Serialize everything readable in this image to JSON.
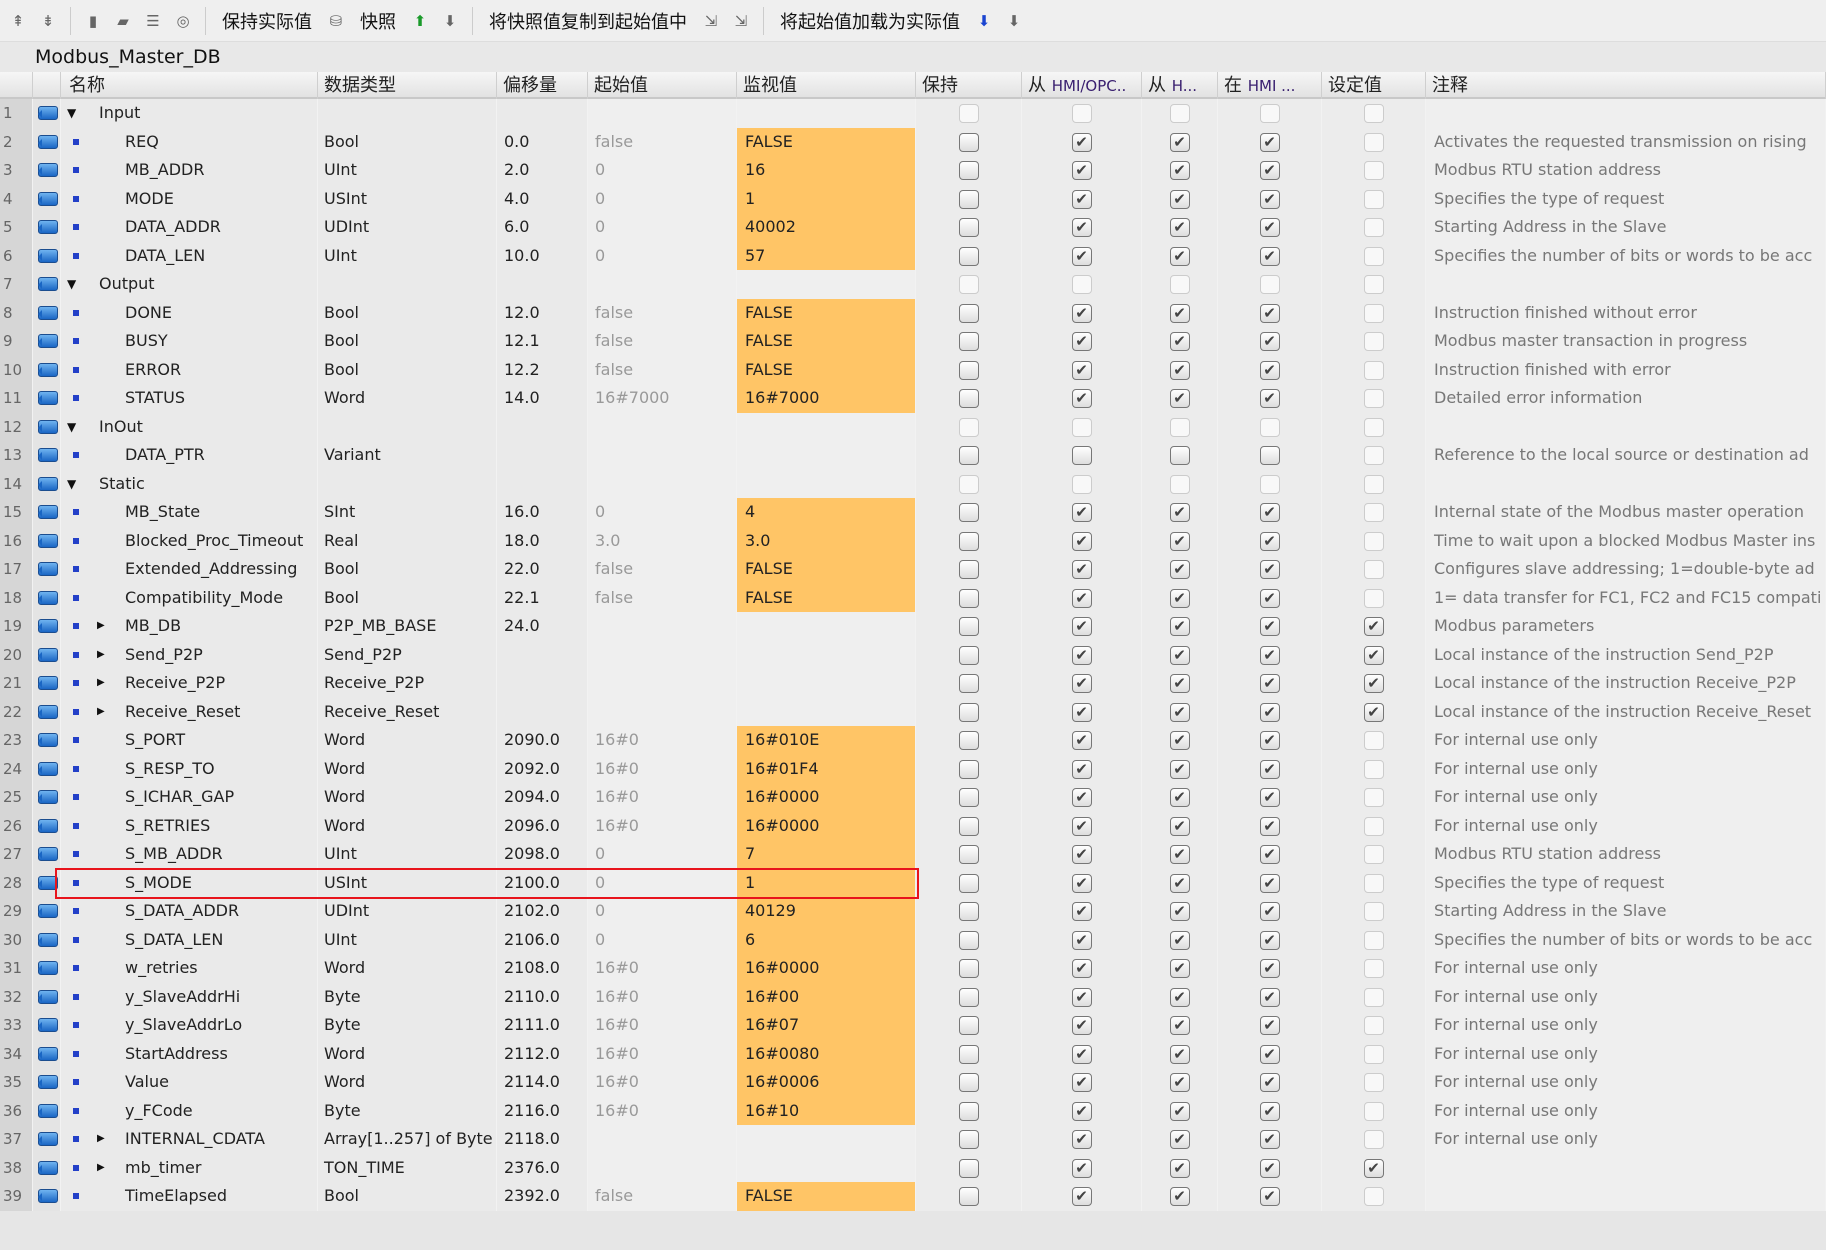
{
  "toolbar": {
    "items": [
      {
        "icon": "insert-row-above-icon"
      },
      {
        "icon": "insert-row-below-icon"
      },
      {
        "sep": true
      },
      {
        "icon": "expand-icon"
      },
      {
        "icon": "collapse-icon"
      },
      {
        "icon": "list-icon"
      },
      {
        "icon": "monitor-glasses-icon"
      },
      {
        "sep": true
      },
      {
        "label": "保持实际值"
      },
      {
        "icon": "snapshot-db-icon"
      },
      {
        "label": "快照"
      },
      {
        "icon": "camera-upload-icon"
      },
      {
        "icon": "camera-download-icon"
      },
      {
        "sep": true
      },
      {
        "label": "将快照值复制到起始值中"
      },
      {
        "icon": "copy-snapshot-icon"
      },
      {
        "icon": "copy-snapshot-2-icon"
      },
      {
        "sep": true
      },
      {
        "label": "将起始值加载为实际值"
      },
      {
        "icon": "load-start-values-icon"
      },
      {
        "icon": "load-start-values-2-icon"
      }
    ]
  },
  "title": "Modbus_Master_DB",
  "columns": {
    "name": "名称",
    "datatype": "数据类型",
    "offset": "偏移量",
    "start": "起始值",
    "monitor": "监视值",
    "retain": "保持",
    "hmi_opc_prefix": "从 ",
    "hmi_opc": "HMI/OPC..",
    "from_h_prefix": "从 ",
    "from_h": "H...",
    "in_hmi_prefix": "在 ",
    "in_hmi": "HMI ...",
    "setpoint": "设定值",
    "comment": "注释"
  },
  "rows": [
    {
      "n": "1",
      "kind": "section",
      "name": "Input"
    },
    {
      "n": "2",
      "name": "REQ",
      "type": "Bool",
      "offset": "0.0",
      "start": "false",
      "monitor": "FALSE",
      "hmi": [
        1,
        1,
        1
      ],
      "sp": 0,
      "comment": "Activates the requested transmission on rising"
    },
    {
      "n": "3",
      "name": "MB_ADDR",
      "type": "UInt",
      "offset": "2.0",
      "start": "0",
      "monitor": "16",
      "hmi": [
        1,
        1,
        1
      ],
      "sp": 0,
      "comment": "Modbus RTU station address"
    },
    {
      "n": "4",
      "name": "MODE",
      "type": "USInt",
      "offset": "4.0",
      "start": "0",
      "monitor": "1",
      "hmi": [
        1,
        1,
        1
      ],
      "sp": 0,
      "comment": "Specifies the type of request"
    },
    {
      "n": "5",
      "name": "DATA_ADDR",
      "type": "UDInt",
      "offset": "6.0",
      "start": "0",
      "monitor": "40002",
      "hmi": [
        1,
        1,
        1
      ],
      "sp": 0,
      "comment": "Starting Address in the Slave"
    },
    {
      "n": "6",
      "name": "DATA_LEN",
      "type": "UInt",
      "offset": "10.0",
      "start": "0",
      "monitor": "57",
      "hmi": [
        1,
        1,
        1
      ],
      "sp": 0,
      "comment": "Specifies the number of bits or words to be acc"
    },
    {
      "n": "7",
      "kind": "section",
      "name": "Output"
    },
    {
      "n": "8",
      "name": "DONE",
      "type": "Bool",
      "offset": "12.0",
      "start": "false",
      "monitor": "FALSE",
      "hmi": [
        1,
        1,
        1
      ],
      "sp": 0,
      "comment": "Instruction finished without error"
    },
    {
      "n": "9",
      "name": "BUSY",
      "type": "Bool",
      "offset": "12.1",
      "start": "false",
      "monitor": "FALSE",
      "hmi": [
        1,
        1,
        1
      ],
      "sp": 0,
      "comment": "Modbus master transaction in progress"
    },
    {
      "n": "10",
      "name": "ERROR",
      "type": "Bool",
      "offset": "12.2",
      "start": "false",
      "monitor": "FALSE",
      "hmi": [
        1,
        1,
        1
      ],
      "sp": 0,
      "comment": "Instruction finished with error"
    },
    {
      "n": "11",
      "name": "STATUS",
      "type": "Word",
      "offset": "14.0",
      "start": "16#7000",
      "monitor": "16#7000",
      "hmi": [
        1,
        1,
        1
      ],
      "sp": 0,
      "comment": "Detailed error information"
    },
    {
      "n": "12",
      "kind": "section",
      "name": "InOut"
    },
    {
      "n": "13",
      "name": "DATA_PTR",
      "type": "Variant",
      "offset": "",
      "start": "",
      "monitor": "",
      "hmi": [
        0,
        0,
        0
      ],
      "sp": 0,
      "comment": "Reference to the local source or destination ad"
    },
    {
      "n": "14",
      "kind": "section",
      "name": "Static"
    },
    {
      "n": "15",
      "name": "MB_State",
      "type": "SInt",
      "offset": "16.0",
      "start": "0",
      "monitor": "4",
      "hmi": [
        1,
        1,
        1
      ],
      "sp": 0,
      "comment": "Internal state of the Modbus master operation"
    },
    {
      "n": "16",
      "name": "Blocked_Proc_Timeout",
      "type": "Real",
      "offset": "18.0",
      "start": "3.0",
      "monitor": "3.0",
      "hmi": [
        1,
        1,
        1
      ],
      "sp": 0,
      "comment": "Time to wait upon a blocked Modbus Master ins"
    },
    {
      "n": "17",
      "name": "Extended_Addressing",
      "type": "Bool",
      "offset": "22.0",
      "start": "false",
      "monitor": "FALSE",
      "hmi": [
        1,
        1,
        1
      ],
      "sp": 0,
      "comment": "Configures slave addressing; 1=double-byte ad"
    },
    {
      "n": "18",
      "name": "Compatibility_Mode",
      "type": "Bool",
      "offset": "22.1",
      "start": "false",
      "monitor": "FALSE",
      "hmi": [
        1,
        1,
        1
      ],
      "sp": 0,
      "comment": "1= data transfer for FC1, FC2 and FC15 compati"
    },
    {
      "n": "19",
      "expand": true,
      "name": "MB_DB",
      "type": "P2P_MB_BASE",
      "offset": "24.0",
      "start": "",
      "monitor": "",
      "hmi": [
        1,
        1,
        1
      ],
      "sp": 1,
      "comment": "Modbus parameters"
    },
    {
      "n": "20",
      "expand": true,
      "name": "Send_P2P",
      "type": "Send_P2P",
      "offset": "",
      "start": "",
      "monitor": "",
      "hmi": [
        1,
        1,
        1
      ],
      "sp": 1,
      "comment": "Local instance of the instruction Send_P2P"
    },
    {
      "n": "21",
      "expand": true,
      "name": "Receive_P2P",
      "type": "Receive_P2P",
      "offset": "",
      "start": "",
      "monitor": "",
      "hmi": [
        1,
        1,
        1
      ],
      "sp": 1,
      "comment": "Local instance of the instruction Receive_P2P"
    },
    {
      "n": "22",
      "expand": true,
      "name": "Receive_Reset",
      "type": "Receive_Reset",
      "offset": "",
      "start": "",
      "monitor": "",
      "hmi": [
        1,
        1,
        1
      ],
      "sp": 1,
      "comment": "Local instance of the instruction Receive_Reset"
    },
    {
      "n": "23",
      "name": "S_PORT",
      "type": "Word",
      "offset": "2090.0",
      "start": "16#0",
      "monitor": "16#010E",
      "hmi": [
        1,
        1,
        1
      ],
      "sp": 0,
      "comment": "For internal use only"
    },
    {
      "n": "24",
      "name": "S_RESP_TO",
      "type": "Word",
      "offset": "2092.0",
      "start": "16#0",
      "monitor": "16#01F4",
      "hmi": [
        1,
        1,
        1
      ],
      "sp": 0,
      "comment": "For internal use only"
    },
    {
      "n": "25",
      "name": "S_ICHAR_GAP",
      "type": "Word",
      "offset": "2094.0",
      "start": "16#0",
      "monitor": "16#0000",
      "hmi": [
        1,
        1,
        1
      ],
      "sp": 0,
      "comment": "For internal use only"
    },
    {
      "n": "26",
      "name": "S_RETRIES",
      "type": "Word",
      "offset": "2096.0",
      "start": "16#0",
      "monitor": "16#0000",
      "hmi": [
        1,
        1,
        1
      ],
      "sp": 0,
      "comment": "For internal use only"
    },
    {
      "n": "27",
      "name": "S_MB_ADDR",
      "type": "UInt",
      "offset": "2098.0",
      "start": "0",
      "monitor": "7",
      "hmi": [
        1,
        1,
        1
      ],
      "sp": 0,
      "comment": "Modbus RTU station address"
    },
    {
      "n": "28",
      "name": "S_MODE",
      "type": "USInt",
      "offset": "2100.0",
      "start": "0",
      "monitor": "1",
      "hmi": [
        1,
        1,
        1
      ],
      "sp": 0,
      "comment": "Specifies the type of request",
      "highlight": true
    },
    {
      "n": "29",
      "name": "S_DATA_ADDR",
      "type": "UDInt",
      "offset": "2102.0",
      "start": "0",
      "monitor": "40129",
      "hmi": [
        1,
        1,
        1
      ],
      "sp": 0,
      "comment": "Starting Address in the Slave"
    },
    {
      "n": "30",
      "name": "S_DATA_LEN",
      "type": "UInt",
      "offset": "2106.0",
      "start": "0",
      "monitor": "6",
      "hmi": [
        1,
        1,
        1
      ],
      "sp": 0,
      "comment": "Specifies the number of bits or words to be acc"
    },
    {
      "n": "31",
      "name": "w_retries",
      "type": "Word",
      "offset": "2108.0",
      "start": "16#0",
      "monitor": "16#0000",
      "hmi": [
        1,
        1,
        1
      ],
      "sp": 0,
      "comment": "For internal use only"
    },
    {
      "n": "32",
      "name": "y_SlaveAddrHi",
      "type": "Byte",
      "offset": "2110.0",
      "start": "16#0",
      "monitor": "16#00",
      "hmi": [
        1,
        1,
        1
      ],
      "sp": 0,
      "comment": "For internal use only"
    },
    {
      "n": "33",
      "name": "y_SlaveAddrLo",
      "type": "Byte",
      "offset": "2111.0",
      "start": "16#0",
      "monitor": "16#07",
      "hmi": [
        1,
        1,
        1
      ],
      "sp": 0,
      "comment": "For internal use only"
    },
    {
      "n": "34",
      "name": "StartAddress",
      "type": "Word",
      "offset": "2112.0",
      "start": "16#0",
      "monitor": "16#0080",
      "hmi": [
        1,
        1,
        1
      ],
      "sp": 0,
      "comment": "For internal use only"
    },
    {
      "n": "35",
      "name": "Value",
      "type": "Word",
      "offset": "2114.0",
      "start": "16#0",
      "monitor": "16#0006",
      "hmi": [
        1,
        1,
        1
      ],
      "sp": 0,
      "comment": "For internal use only"
    },
    {
      "n": "36",
      "name": "y_FCode",
      "type": "Byte",
      "offset": "2116.0",
      "start": "16#0",
      "monitor": "16#10",
      "hmi": [
        1,
        1,
        1
      ],
      "sp": 0,
      "comment": "For internal use only"
    },
    {
      "n": "37",
      "expand": true,
      "name": "INTERNAL_CDATA",
      "type": "Array[1..257] of Byte",
      "offset": "2118.0",
      "start": "",
      "monitor": "",
      "hmi": [
        1,
        1,
        1
      ],
      "sp": 0,
      "comment": "For internal use only"
    },
    {
      "n": "38",
      "expand": true,
      "name": "mb_timer",
      "type": "TON_TIME",
      "offset": "2376.0",
      "start": "",
      "monitor": "",
      "hmi": [
        1,
        1,
        1
      ],
      "sp": 1,
      "comment": ""
    },
    {
      "n": "39",
      "name": "TimeElapsed",
      "type": "Bool",
      "offset": "2392.0",
      "start": "false",
      "monitor": "FALSE",
      "hmi": [
        1,
        1,
        1
      ],
      "sp": 0,
      "comment": ""
    }
  ]
}
